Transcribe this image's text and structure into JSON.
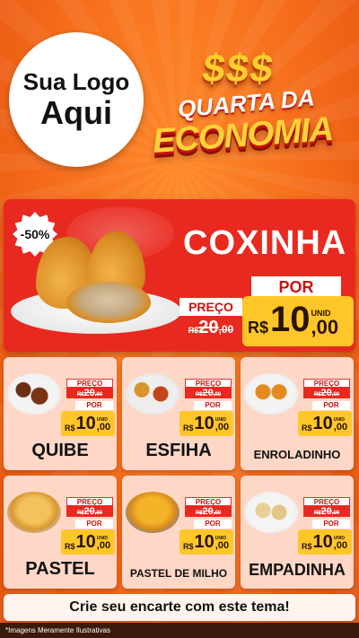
{
  "logo": {
    "line1": "Sua Logo",
    "line2": "Aqui"
  },
  "header": {
    "dollars": "$$$",
    "title_top": "QUARTA DA",
    "title_bottom": "ECONOMIA"
  },
  "hero": {
    "badge": "-50%",
    "name": "COXINHA",
    "preco_label": "PREÇO",
    "old_currency": "R$",
    "old_int": "20",
    "old_cents": ",00",
    "por_label": "POR",
    "currency": "R$",
    "new_int": "10",
    "unit": "UNID",
    "new_cents": ",00"
  },
  "products": [
    {
      "name": "QUIBE",
      "preco_label": "PREÇO",
      "old_currency": "R$",
      "old_int": "20",
      "old_cents": ",00",
      "por_label": "POR",
      "currency": "R$",
      "new_int": "10",
      "unit": "UNID",
      "new_cents": ",00"
    },
    {
      "name": "ESFIHA",
      "preco_label": "PREÇO",
      "old_currency": "R$",
      "old_int": "20",
      "old_cents": ",00",
      "por_label": "POR",
      "currency": "R$",
      "new_int": "10",
      "unit": "UNID",
      "new_cents": ",00"
    },
    {
      "name": "ENROLADINHO",
      "preco_label": "PREÇO",
      "old_currency": "R$",
      "old_int": "20",
      "old_cents": ",00",
      "por_label": "POR",
      "currency": "R$",
      "new_int": "10",
      "unit": "UNID",
      "new_cents": ",00"
    },
    {
      "name": "PASTEL",
      "preco_label": "PREÇO",
      "old_currency": "R$",
      "old_int": "20",
      "old_cents": ",00",
      "por_label": "POR",
      "currency": "R$",
      "new_int": "10",
      "unit": "UNID",
      "new_cents": ",00"
    },
    {
      "name": "PASTEL DE MILHO",
      "preco_label": "PREÇO",
      "old_currency": "R$",
      "old_int": "20",
      "old_cents": ",00",
      "por_label": "POR",
      "currency": "R$",
      "new_int": "10",
      "unit": "UNID",
      "new_cents": ",00"
    },
    {
      "name": "EMPADINHA",
      "preco_label": "PREÇO",
      "old_currency": "R$",
      "old_int": "20",
      "old_cents": ",00",
      "por_label": "POR",
      "currency": "R$",
      "new_int": "10",
      "unit": "UNID",
      "new_cents": ",00"
    }
  ],
  "footer": {
    "cta": "Crie seu encarte com este tema!",
    "disclaimer": "*Imagens Meramente Ilustrativas"
  },
  "colors": {
    "background": "#f46a1a",
    "hero_red": "#e8291f",
    "price_yellow": "#ffc629",
    "card_bg": "#ffd7c6"
  }
}
